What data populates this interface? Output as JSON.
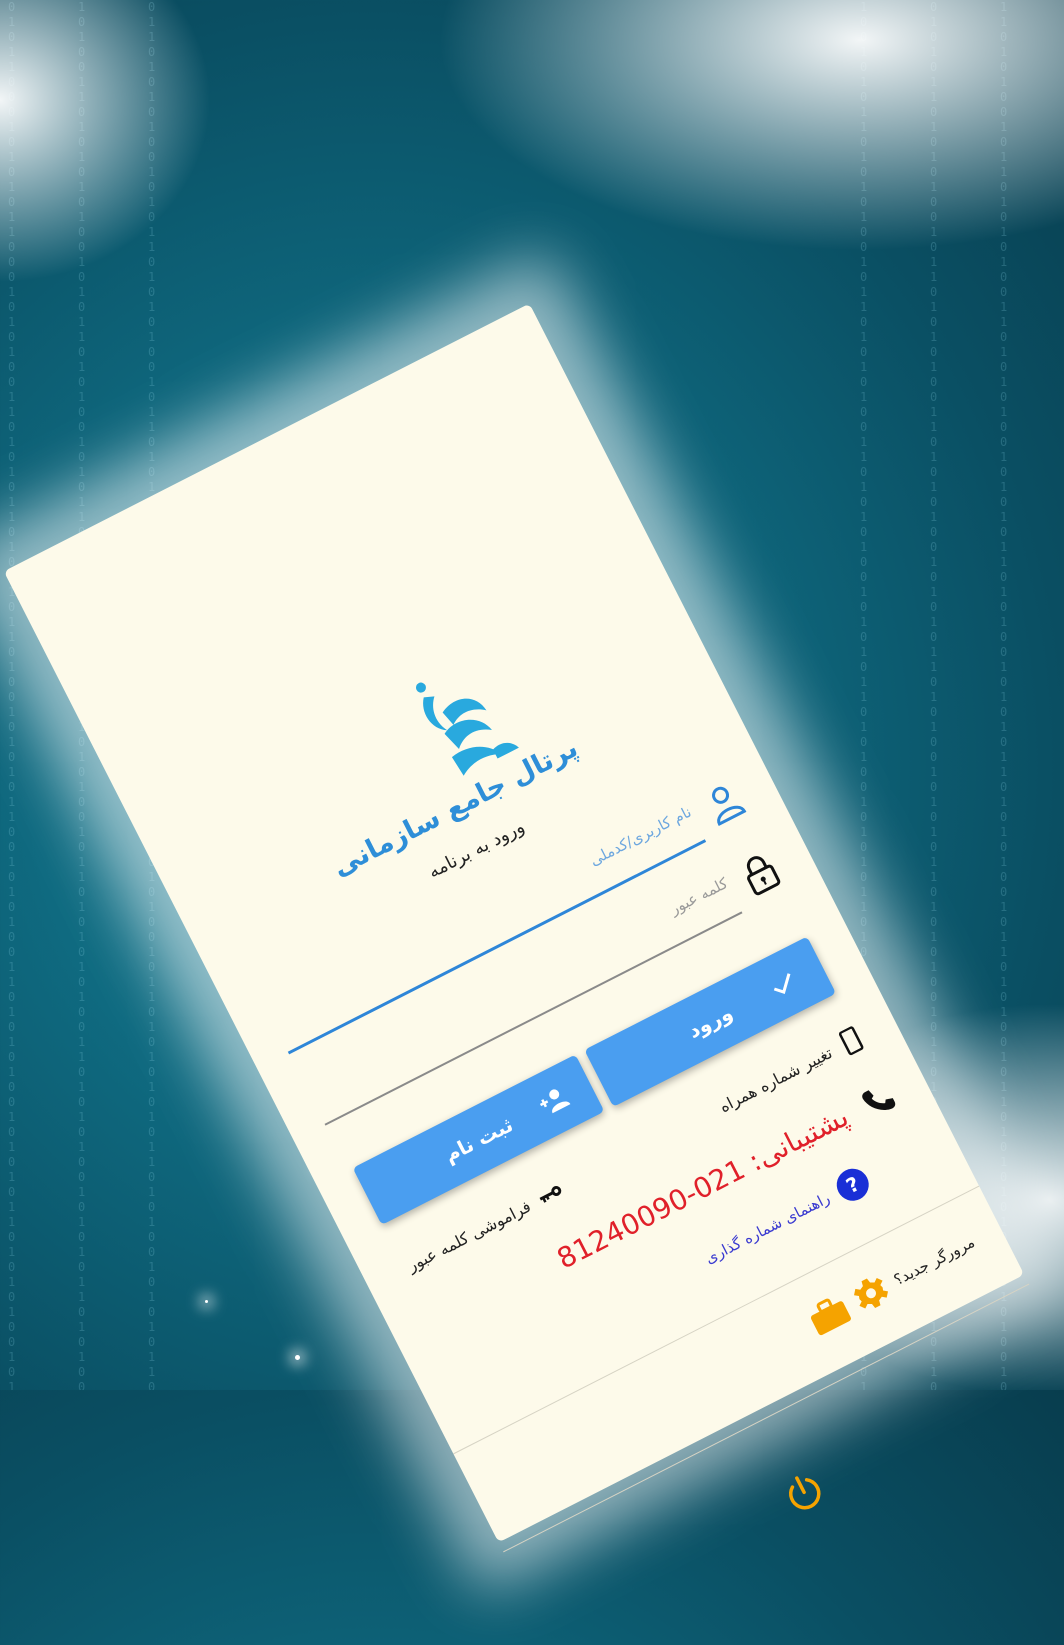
{
  "app": {
    "title": "پرتال جامع سازمانی",
    "subtitle": "ورود به برنامه"
  },
  "form": {
    "username_label": "نام کاربری/کدملی",
    "username_value": "",
    "password_label": "کلمه عبور",
    "password_value": ""
  },
  "buttons": {
    "login_label": "ورود",
    "signup_label": "ثبت نام"
  },
  "links": {
    "change_phone": "تغییر شماره همراه",
    "forgot_password": "فراموشی کلمه عبور",
    "numbering_guide": "راهنمای شماره گذاری",
    "new_browser": "مرورگر جدید؟"
  },
  "support": {
    "label": "پشتیبانی:",
    "phone": "021-81240090"
  },
  "colors": {
    "accent": "#4a9ef0",
    "title": "#2e8ed8",
    "support": "#e0202a",
    "orange": "#f5a300",
    "background": "#fdfaea"
  },
  "icons": [
    "logo-icon",
    "user-icon",
    "lock-icon",
    "check-icon",
    "add-user-icon",
    "mobile-icon",
    "phone-icon",
    "key-icon",
    "help-icon",
    "gear-icon",
    "briefcase-icon",
    "power-icon"
  ]
}
